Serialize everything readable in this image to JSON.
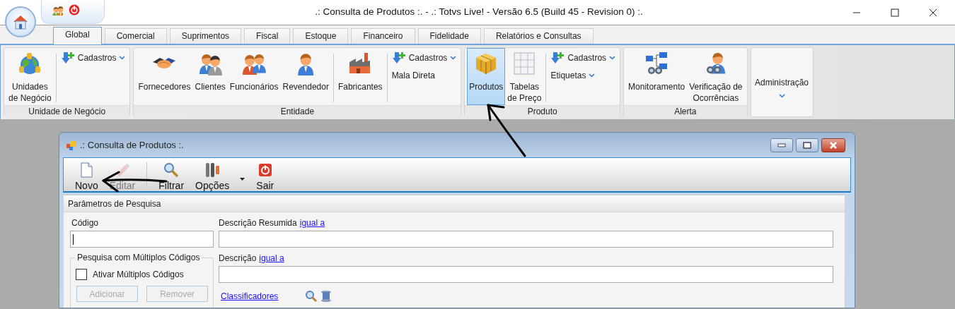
{
  "window": {
    "title": ".: Consulta de Produtos :. - .: Totvs Live! - Versão 6.5 (Build 45 - Revision 0) :."
  },
  "ribbon": {
    "tabs": [
      {
        "label": "Global",
        "selected": true
      },
      {
        "label": "Comercial",
        "selected": false
      },
      {
        "label": "Suprimentos",
        "selected": false
      },
      {
        "label": "Fiscal",
        "selected": false
      },
      {
        "label": "Estoque",
        "selected": false
      },
      {
        "label": "Financeiro",
        "selected": false
      },
      {
        "label": "Fidelidade",
        "selected": false
      },
      {
        "label": "Relatórios e Consultas",
        "selected": false
      }
    ],
    "groups": [
      {
        "label": "Unidade de Negócio",
        "columns": [
          {
            "kind": "large",
            "label": "Unidades\nde Negócio",
            "selected": false
          },
          {
            "kind": "separator"
          },
          {
            "kind": "stack",
            "items": [
              {
                "kind": "menu",
                "label": "Cadastros"
              }
            ]
          }
        ]
      },
      {
        "label": "Entidade",
        "columns": [
          {
            "kind": "large",
            "label": "Fornecedores",
            "selected": false
          },
          {
            "kind": "large",
            "label": "Clientes",
            "selected": false
          },
          {
            "kind": "large",
            "label": "Funcionários",
            "selected": false
          },
          {
            "kind": "large",
            "label": "Revendedor",
            "selected": false
          },
          {
            "kind": "separator"
          },
          {
            "kind": "large",
            "label": "Fabricantes",
            "selected": false
          },
          {
            "kind": "separator"
          },
          {
            "kind": "stack",
            "items": [
              {
                "kind": "menu",
                "label": "Cadastros"
              },
              {
                "kind": "plain",
                "label": "Mala Direta"
              }
            ]
          }
        ]
      },
      {
        "label": "Produto",
        "columns": [
          {
            "kind": "large",
            "label": "Produtos",
            "selected": true
          },
          {
            "kind": "large",
            "label": "Tabelas\nde Preço",
            "selected": false
          },
          {
            "kind": "separator"
          },
          {
            "kind": "stack",
            "items": [
              {
                "kind": "menu",
                "label": "Cadastros"
              },
              {
                "kind": "dropdown",
                "label": "Etiquetas"
              }
            ]
          }
        ]
      },
      {
        "label": "Alerta",
        "columns": [
          {
            "kind": "large",
            "label": "Monitoramento",
            "selected": false
          },
          {
            "kind": "large",
            "label": "Verificação de\nOcorrências",
            "selected": false
          }
        ]
      },
      {
        "columns": [
          {
            "kind": "large_dropdown",
            "label": "Administração"
          }
        ]
      }
    ]
  },
  "child_window": {
    "title": ".: Consulta de Produtos :.",
    "toolbar": [
      {
        "kind": "button",
        "label": "Novo",
        "disabled": false
      },
      {
        "kind": "button",
        "label": "Editar",
        "disabled": true
      },
      {
        "kind": "separator"
      },
      {
        "kind": "button",
        "label": "Filtrar",
        "disabled": false
      },
      {
        "kind": "dropdown",
        "label": "Opções",
        "disabled": false
      },
      {
        "kind": "button",
        "label": "Sair",
        "disabled": false
      }
    ],
    "panel": {
      "title": "Parâmetros de Pesquisa",
      "code": {
        "label": "Código",
        "focused": true
      },
      "multi": {
        "title": "Pesquisa com Múltiplos Códigos",
        "checkbox": {
          "label": "Ativar Múltiplos Códigos",
          "checked": false
        },
        "buttons": [
          {
            "label": "Adicionar",
            "disabled": true
          },
          {
            "label": "Remover",
            "disabled": true
          }
        ]
      },
      "short_description": {
        "label": "Descrição Resumida",
        "link": "igual a "
      },
      "description": {
        "label": "Descrição",
        "link": "igual a "
      },
      "classifiers_link": "Classificadores"
    }
  }
}
